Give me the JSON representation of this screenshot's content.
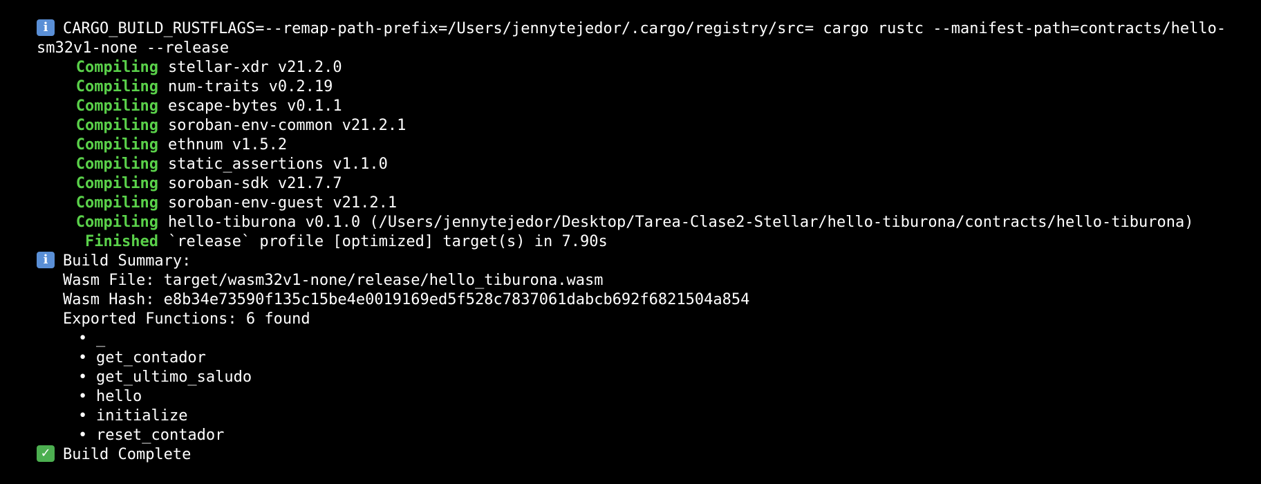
{
  "terminal": {
    "command_line_1": "CARGO_BUILD_RUSTFLAGS=--remap-path-prefix=/Users/jennytejedor/.cargo/registry/src= cargo rustc --manifest-path=contracts/hello-",
    "command_line_2": "sm32v1-none --release",
    "compile_lines": [
      {
        "status": "Compiling",
        "package": "stellar-xdr v21.2.0"
      },
      {
        "status": "Compiling",
        "package": "num-traits v0.2.19"
      },
      {
        "status": "Compiling",
        "package": "escape-bytes v0.1.1"
      },
      {
        "status": "Compiling",
        "package": "soroban-env-common v21.2.1"
      },
      {
        "status": "Compiling",
        "package": "ethnum v1.5.2"
      },
      {
        "status": "Compiling",
        "package": "static_assertions v1.1.0"
      },
      {
        "status": "Compiling",
        "package": "soroban-sdk v21.7.7"
      },
      {
        "status": "Compiling",
        "package": "soroban-env-guest v21.2.1"
      },
      {
        "status": "Compiling",
        "package": "hello-tiburona v0.1.0 (/Users/jennytejedor/Desktop/Tarea-Clase2-Stellar/hello-tiburona/contracts/hello-tiburona)"
      }
    ],
    "finished": {
      "status": "Finished",
      "text": "`release` profile [optimized] target(s) in 7.90s"
    },
    "build_summary_title": "Build Summary:",
    "wasm_file": "Wasm File: target/wasm32v1-none/release/hello_tiburona.wasm",
    "wasm_hash": "Wasm Hash: e8b34e73590f135c15be4e0019169ed5f528c7837061dabcb692f6821504a854",
    "exported_functions": "Exported Functions: 6 found",
    "functions": [
      "_",
      "get_contador",
      "get_ultimo_saludo",
      "hello",
      "initialize",
      "reset_contador"
    ],
    "build_complete": "Build Complete",
    "bullet_glyph": "•",
    "info_glyph": "i",
    "check_glyph": "✓"
  },
  "colors": {
    "background": "#000000",
    "text": "#ffffff",
    "status_green": "#5ad14a",
    "info_blue": "#5a8fd6",
    "check_green": "#4caf50"
  },
  "icons": {
    "info": "info-icon",
    "check": "check-icon"
  }
}
